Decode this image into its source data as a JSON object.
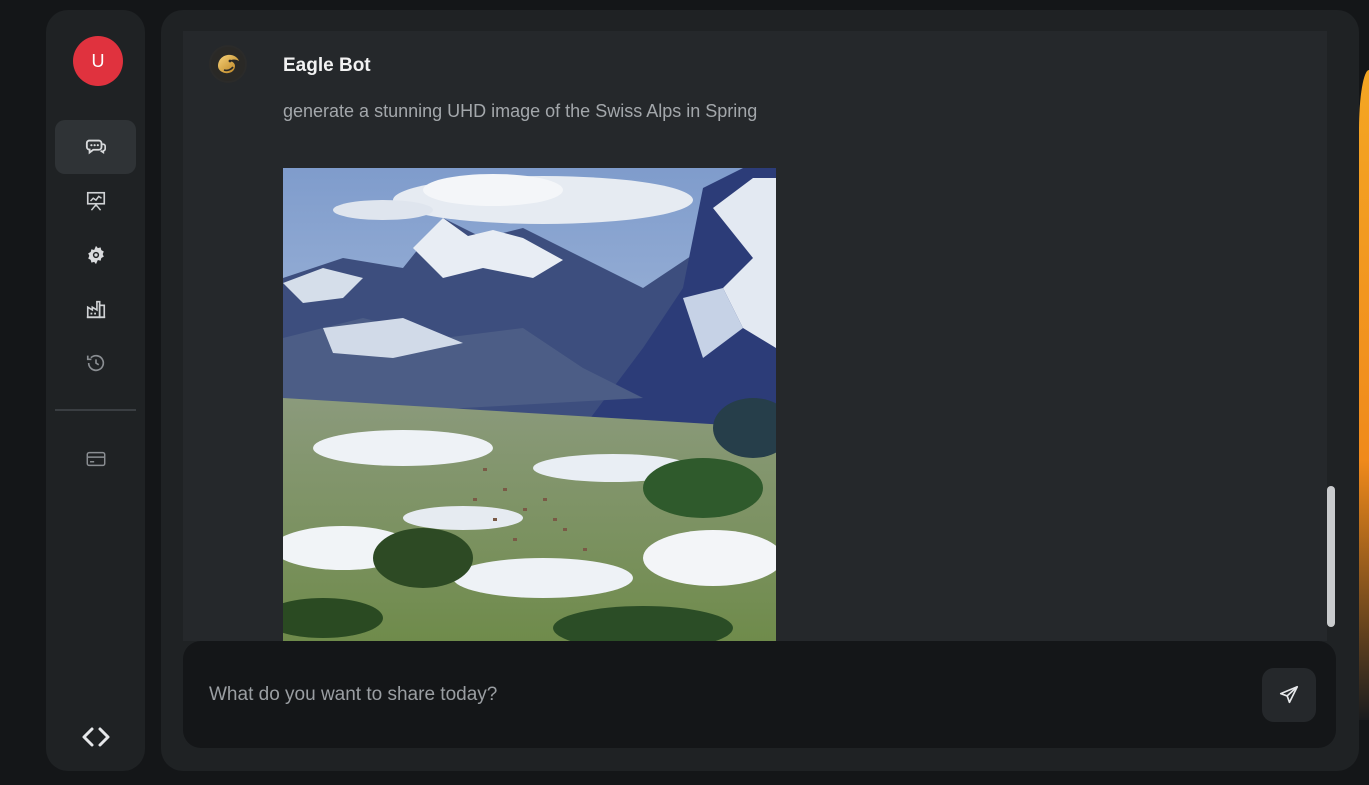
{
  "user": {
    "avatar_initial": "U"
  },
  "sidebar": {
    "items": [
      {
        "name": "chat",
        "icon": "chat-bubbles-icon",
        "active": true
      },
      {
        "name": "presentation",
        "icon": "presentation-chart-icon",
        "active": false
      },
      {
        "name": "settings",
        "icon": "gear-icon",
        "active": false
      },
      {
        "name": "factory",
        "icon": "factory-icon",
        "active": false
      },
      {
        "name": "history",
        "icon": "history-icon",
        "active": false
      }
    ],
    "billing_icon": "credit-card-icon",
    "toggle_icon": "code-brackets-icon"
  },
  "chat": {
    "bot_name": "Eagle Bot",
    "message": "generate a stunning UHD image of the Swiss Alps in Spring",
    "image_subject": "swiss-alps-landscape"
  },
  "composer": {
    "placeholder": "What do you want to share today?",
    "send_icon": "send-icon"
  },
  "colors": {
    "background": "#141618",
    "panel": "#1f2224",
    "chat_bg": "#25282b",
    "avatar": "#e0323e",
    "accent": "#f4a623"
  }
}
